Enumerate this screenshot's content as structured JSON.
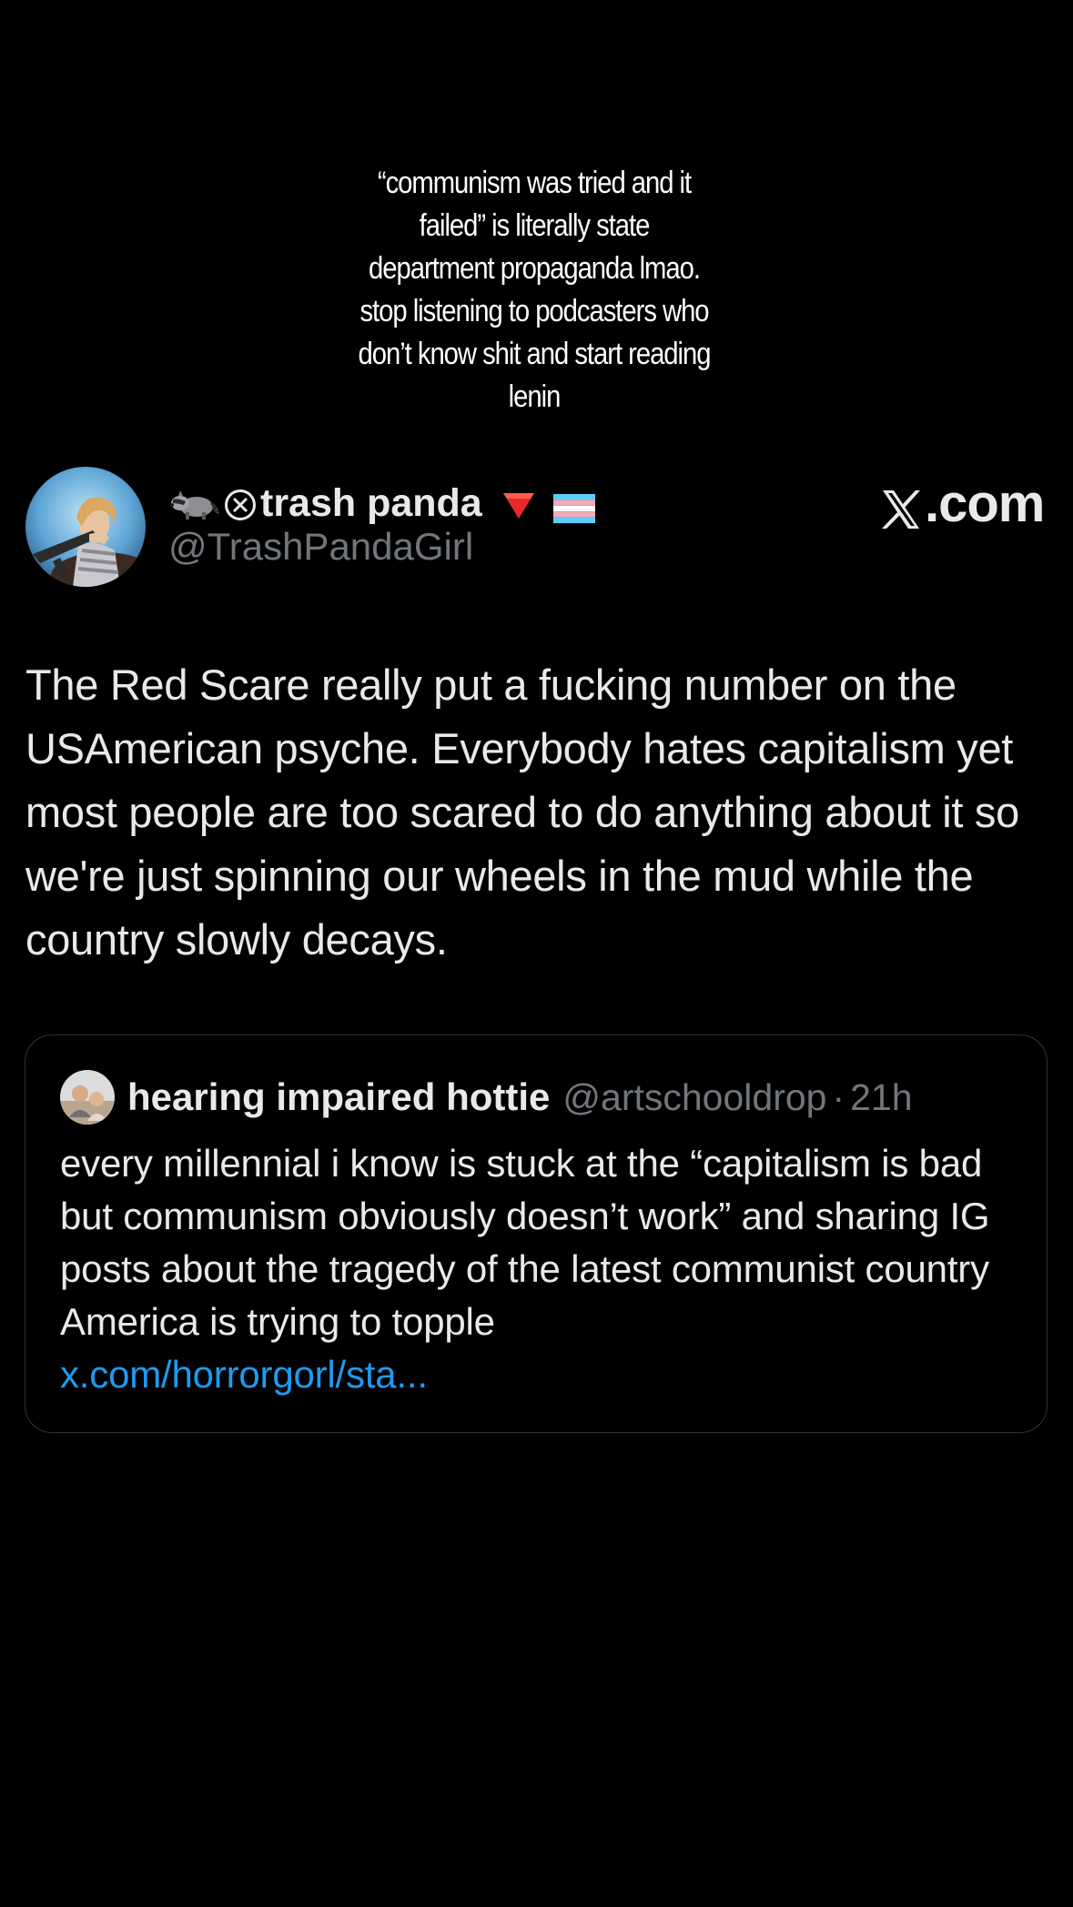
{
  "overlay": {
    "caption": "“communism was tried and it\nfailed” is literally state\ndepartment propaganda lmao.\nstop listening to podcasters who\ndon’t know shit and start reading\nlenin"
  },
  "author": {
    "display_name": "trash panda",
    "handle": "@TrashPandaGirl",
    "name_icons": [
      "raccoon-emoji",
      "circle-x-icon",
      "red-triangle-emoji",
      "transgender-flag-emoji"
    ]
  },
  "brand": {
    "label": ".com",
    "icon": "x-logo-icon"
  },
  "tweet": {
    "text": "The Red Scare really put a fucking number on the USAmerican psyche. Everybody hates capitalism yet most people are too scared to do anything about it so we're just spinning our wheels in the mud while the country slowly decays."
  },
  "quoted_tweet": {
    "display_name": "hearing impaired hottie",
    "handle": "@artschooldrop",
    "separator": "·",
    "time": "21h",
    "text": "every millennial i know is stuck at the “capitalism is bad but communism obviously doesn’t work” and sharing IG posts about the tragedy of the latest communist country America is trying to topple",
    "link": "x.com/horrorgorl/sta..."
  },
  "colors": {
    "background": "#000000",
    "text_primary": "#e7e9ea",
    "text_secondary": "#71767b",
    "link": "#1d9bf0",
    "border": "#2f3336"
  }
}
